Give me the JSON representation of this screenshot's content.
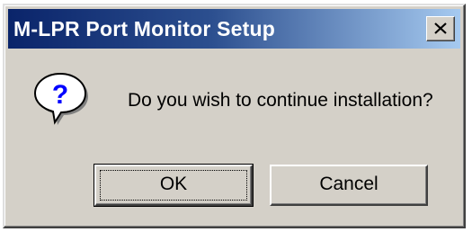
{
  "window": {
    "title": "M-LPR Port Monitor Setup",
    "close_symbol": "×"
  },
  "dialog": {
    "icon": "question-icon",
    "icon_glyph": "?",
    "message": "Do you wish to continue installation?"
  },
  "buttons": {
    "ok_label": "OK",
    "cancel_label": "Cancel"
  },
  "colors": {
    "titlebar_start": "#0a246a",
    "titlebar_end": "#a6caf0",
    "face": "#d4d0c8"
  }
}
